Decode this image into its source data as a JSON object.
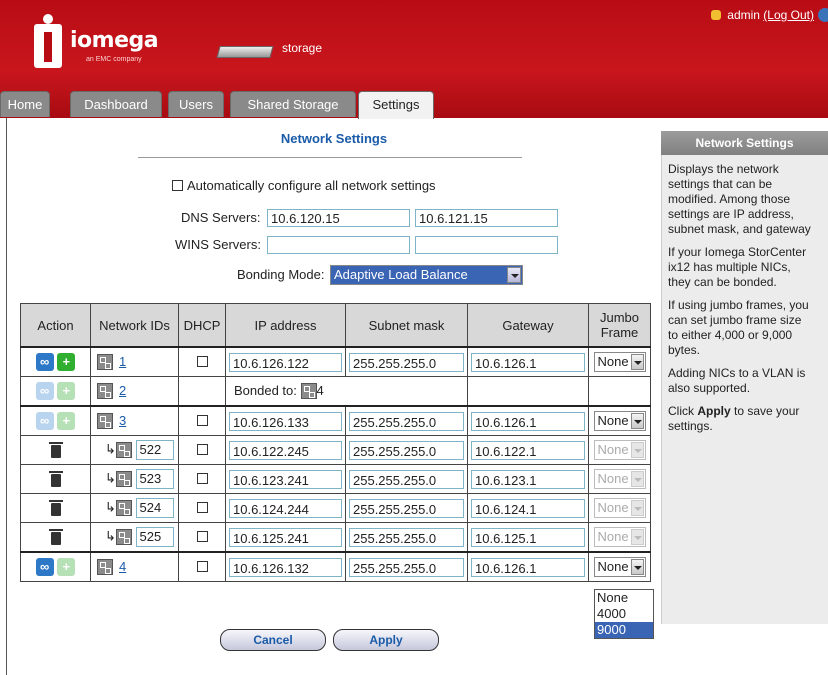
{
  "header": {
    "brand": "iomega",
    "tagline": "an EMC company",
    "product": "storage",
    "user": "admin",
    "logout": "(Log Out)",
    "brand_color": "#c9161d"
  },
  "tabs": [
    {
      "label": "Home"
    },
    {
      "label": "Dashboard"
    },
    {
      "label": "Users"
    },
    {
      "label": "Shared Storage"
    },
    {
      "label": "Settings",
      "active": true
    }
  ],
  "page": {
    "title": "Network Settings",
    "auto_config_label": "Automatically configure all network settings",
    "dns_label": "DNS Servers:",
    "dns1": "10.6.120.15",
    "dns2": "10.6.121.15",
    "wins_label": "WINS Servers:",
    "wins1": "",
    "wins2": "",
    "bonding_label": "Bonding Mode:",
    "bonding_value": "Adaptive Load Balance"
  },
  "table": {
    "headers": [
      "Action",
      "Network IDs",
      "DHCP",
      "IP address",
      "Subnet mask",
      "Gateway",
      "Jumbo Frame"
    ],
    "rows": [
      {
        "id": "1",
        "ip": "10.6.126.122",
        "mask": "255.255.255.0",
        "gw": "10.6.126.1",
        "jumbo": "None"
      },
      {
        "id": "2",
        "bonded_label": "Bonded to:",
        "bonded_to": "4"
      },
      {
        "id": "3",
        "ip": "10.6.126.133",
        "mask": "255.255.255.0",
        "gw": "10.6.126.1",
        "jumbo": "None"
      },
      {
        "vlan": "522",
        "ip": "10.6.122.245",
        "mask": "255.255.255.0",
        "gw": "10.6.122.1",
        "jumbo": "None"
      },
      {
        "vlan": "523",
        "ip": "10.6.123.241",
        "mask": "255.255.255.0",
        "gw": "10.6.123.1",
        "jumbo": "None"
      },
      {
        "vlan": "524",
        "ip": "10.6.124.244",
        "mask": "255.255.255.0",
        "gw": "10.6.124.1",
        "jumbo": "None"
      },
      {
        "vlan": "525",
        "ip": "10.6.125.241",
        "mask": "255.255.255.0",
        "gw": "10.6.125.1",
        "jumbo": "None"
      },
      {
        "id": "4",
        "ip": "10.6.126.132",
        "mask": "255.255.255.0",
        "gw": "10.6.126.1",
        "jumbo": "None"
      }
    ]
  },
  "jumbo_options": [
    "None",
    "4000",
    "9000"
  ],
  "buttons": {
    "cancel": "Cancel",
    "apply": "Apply"
  },
  "help": {
    "title": "Network Settings",
    "p1": [
      "Displays the network",
      "settings that can be",
      "modified. Among those",
      "settings are IP address,",
      "subnet mask, and gateway"
    ],
    "p2": [
      "If your Iomega StorCenter",
      "ix12 has multiple NICs,",
      "they can be bonded."
    ],
    "p3": [
      "If using jumbo frames, you",
      "can set jumbo frame size",
      "to either 4,000 or 9,000",
      "bytes."
    ],
    "p4": [
      "Adding NICs to a VLAN is",
      "also supported."
    ],
    "p5_pre": "Click ",
    "p5_bold": "Apply",
    "p5_post": " to save your",
    "p5_line2": "settings."
  }
}
